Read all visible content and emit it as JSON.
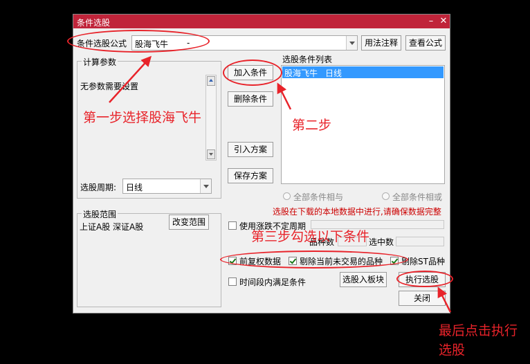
{
  "dialog": {
    "title": "条件选股",
    "formula_label": "条件选股公式",
    "formula_value": "股海飞牛",
    "formula_dash": "-",
    "usage_button": "用法注释",
    "view_formula_button": "查看公式",
    "params_group": "计算参数",
    "params_text": "无参数需要设置",
    "period_label": "选股周期:",
    "period_value": "日线",
    "range_group": "选股范围",
    "range_text": "上证A股 深证A股",
    "change_range_button": "改变范围",
    "add_condition_button": "加入条件",
    "delete_condition_button": "删除条件",
    "import_plan_button": "引入方案",
    "save_plan_button": "保存方案",
    "condition_list_title": "选股条件列表",
    "condition_items": [
      {
        "name": "股海飞牛",
        "period": "日线",
        "selected": true
      }
    ],
    "radio_all_and": "全部条件相与",
    "radio_all_or": "全部条件相或",
    "notice": "选股在下载的本地数据中进行,请确保数据完整",
    "use_limit_period_label": "使用涨跌不定周期",
    "stock_count_label": "品种数",
    "selected_count_label": "选中数",
    "pre_adjust_label": "前复权数据",
    "exclude_untraded_label": "剔除当前未交易的品种",
    "exclude_st_label": "剔除ST品种",
    "time_range_label": "时间段内满足条件",
    "select_to_block_button": "选股入板块",
    "execute_button": "执行选股",
    "close_button": "关闭"
  },
  "annotations": {
    "step1": "第一步选择股海飞牛",
    "step2": "第二步",
    "step3": "第三步勾选以下条件",
    "final": [
      "最后点击执行",
      "选股"
    ]
  },
  "colors": {
    "titlebar": "#c0243a",
    "annotation": "#e8232a",
    "selection": "#3399ff",
    "notice": "#cc0000"
  },
  "state": {
    "pre_adjust_checked": true,
    "exclude_untraded_checked": true,
    "exclude_st_checked": true,
    "use_limit_period_checked": false,
    "time_range_checked": false
  }
}
